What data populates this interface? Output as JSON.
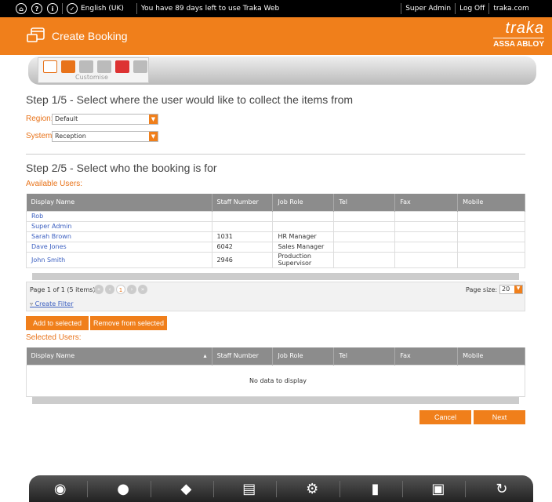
{
  "topbar": {
    "language": "English (UK)",
    "notice": "You have 89 days left to use Traka Web",
    "user": "Super Admin",
    "logoff": "Log Off",
    "site": "traka.com"
  },
  "header": {
    "title": "Create Booking",
    "logo_text": "traka",
    "logo_sub": "ASSA ABLOY"
  },
  "toolbar": {
    "customise_label": "Customise"
  },
  "step1": {
    "heading": "Step 1/5 - Select where the user would like to collect the items from",
    "region_label": "Region:",
    "region_value": "Default",
    "system_label": "System",
    "system_value": "Reception"
  },
  "step2": {
    "heading": "Step 2/5 - Select who the booking is for",
    "available_label": "Available Users:",
    "columns": [
      "Display Name",
      "Staff Number",
      "Job Role",
      "Tel",
      "Fax",
      "Mobile"
    ],
    "rows": [
      [
        "Rob",
        "",
        "",
        "",
        "",
        ""
      ],
      [
        "Super Admin",
        "",
        "",
        "",
        "",
        ""
      ],
      [
        "Sarah Brown",
        "1031",
        "HR Manager",
        "",
        "",
        ""
      ],
      [
        "Dave Jones",
        "6042",
        "Sales Manager",
        "",
        "",
        ""
      ],
      [
        "John Smith",
        "2946",
        "Production Supervisor",
        "",
        "",
        ""
      ]
    ],
    "page_info": "Page 1 of 1 (5 items)",
    "page_current": "1",
    "page_size_label": "Page size:",
    "page_size_value": "20",
    "create_filter": "Create Filter",
    "add_button": "Add to selected",
    "remove_button": "Remove from selected",
    "selected_label": "Selected Users:",
    "no_data": "No data to display"
  },
  "actions": {
    "cancel": "Cancel",
    "next": "Next"
  },
  "colors": {
    "accent": "#f07f1b",
    "link": "#3b5fc0",
    "header_gray": "#8c8c8c"
  },
  "bottom_icons": [
    "eye-icon",
    "user-icon",
    "items-icon",
    "documents-icon",
    "settings-icon",
    "system-icon",
    "screen-icon",
    "history-icon"
  ]
}
